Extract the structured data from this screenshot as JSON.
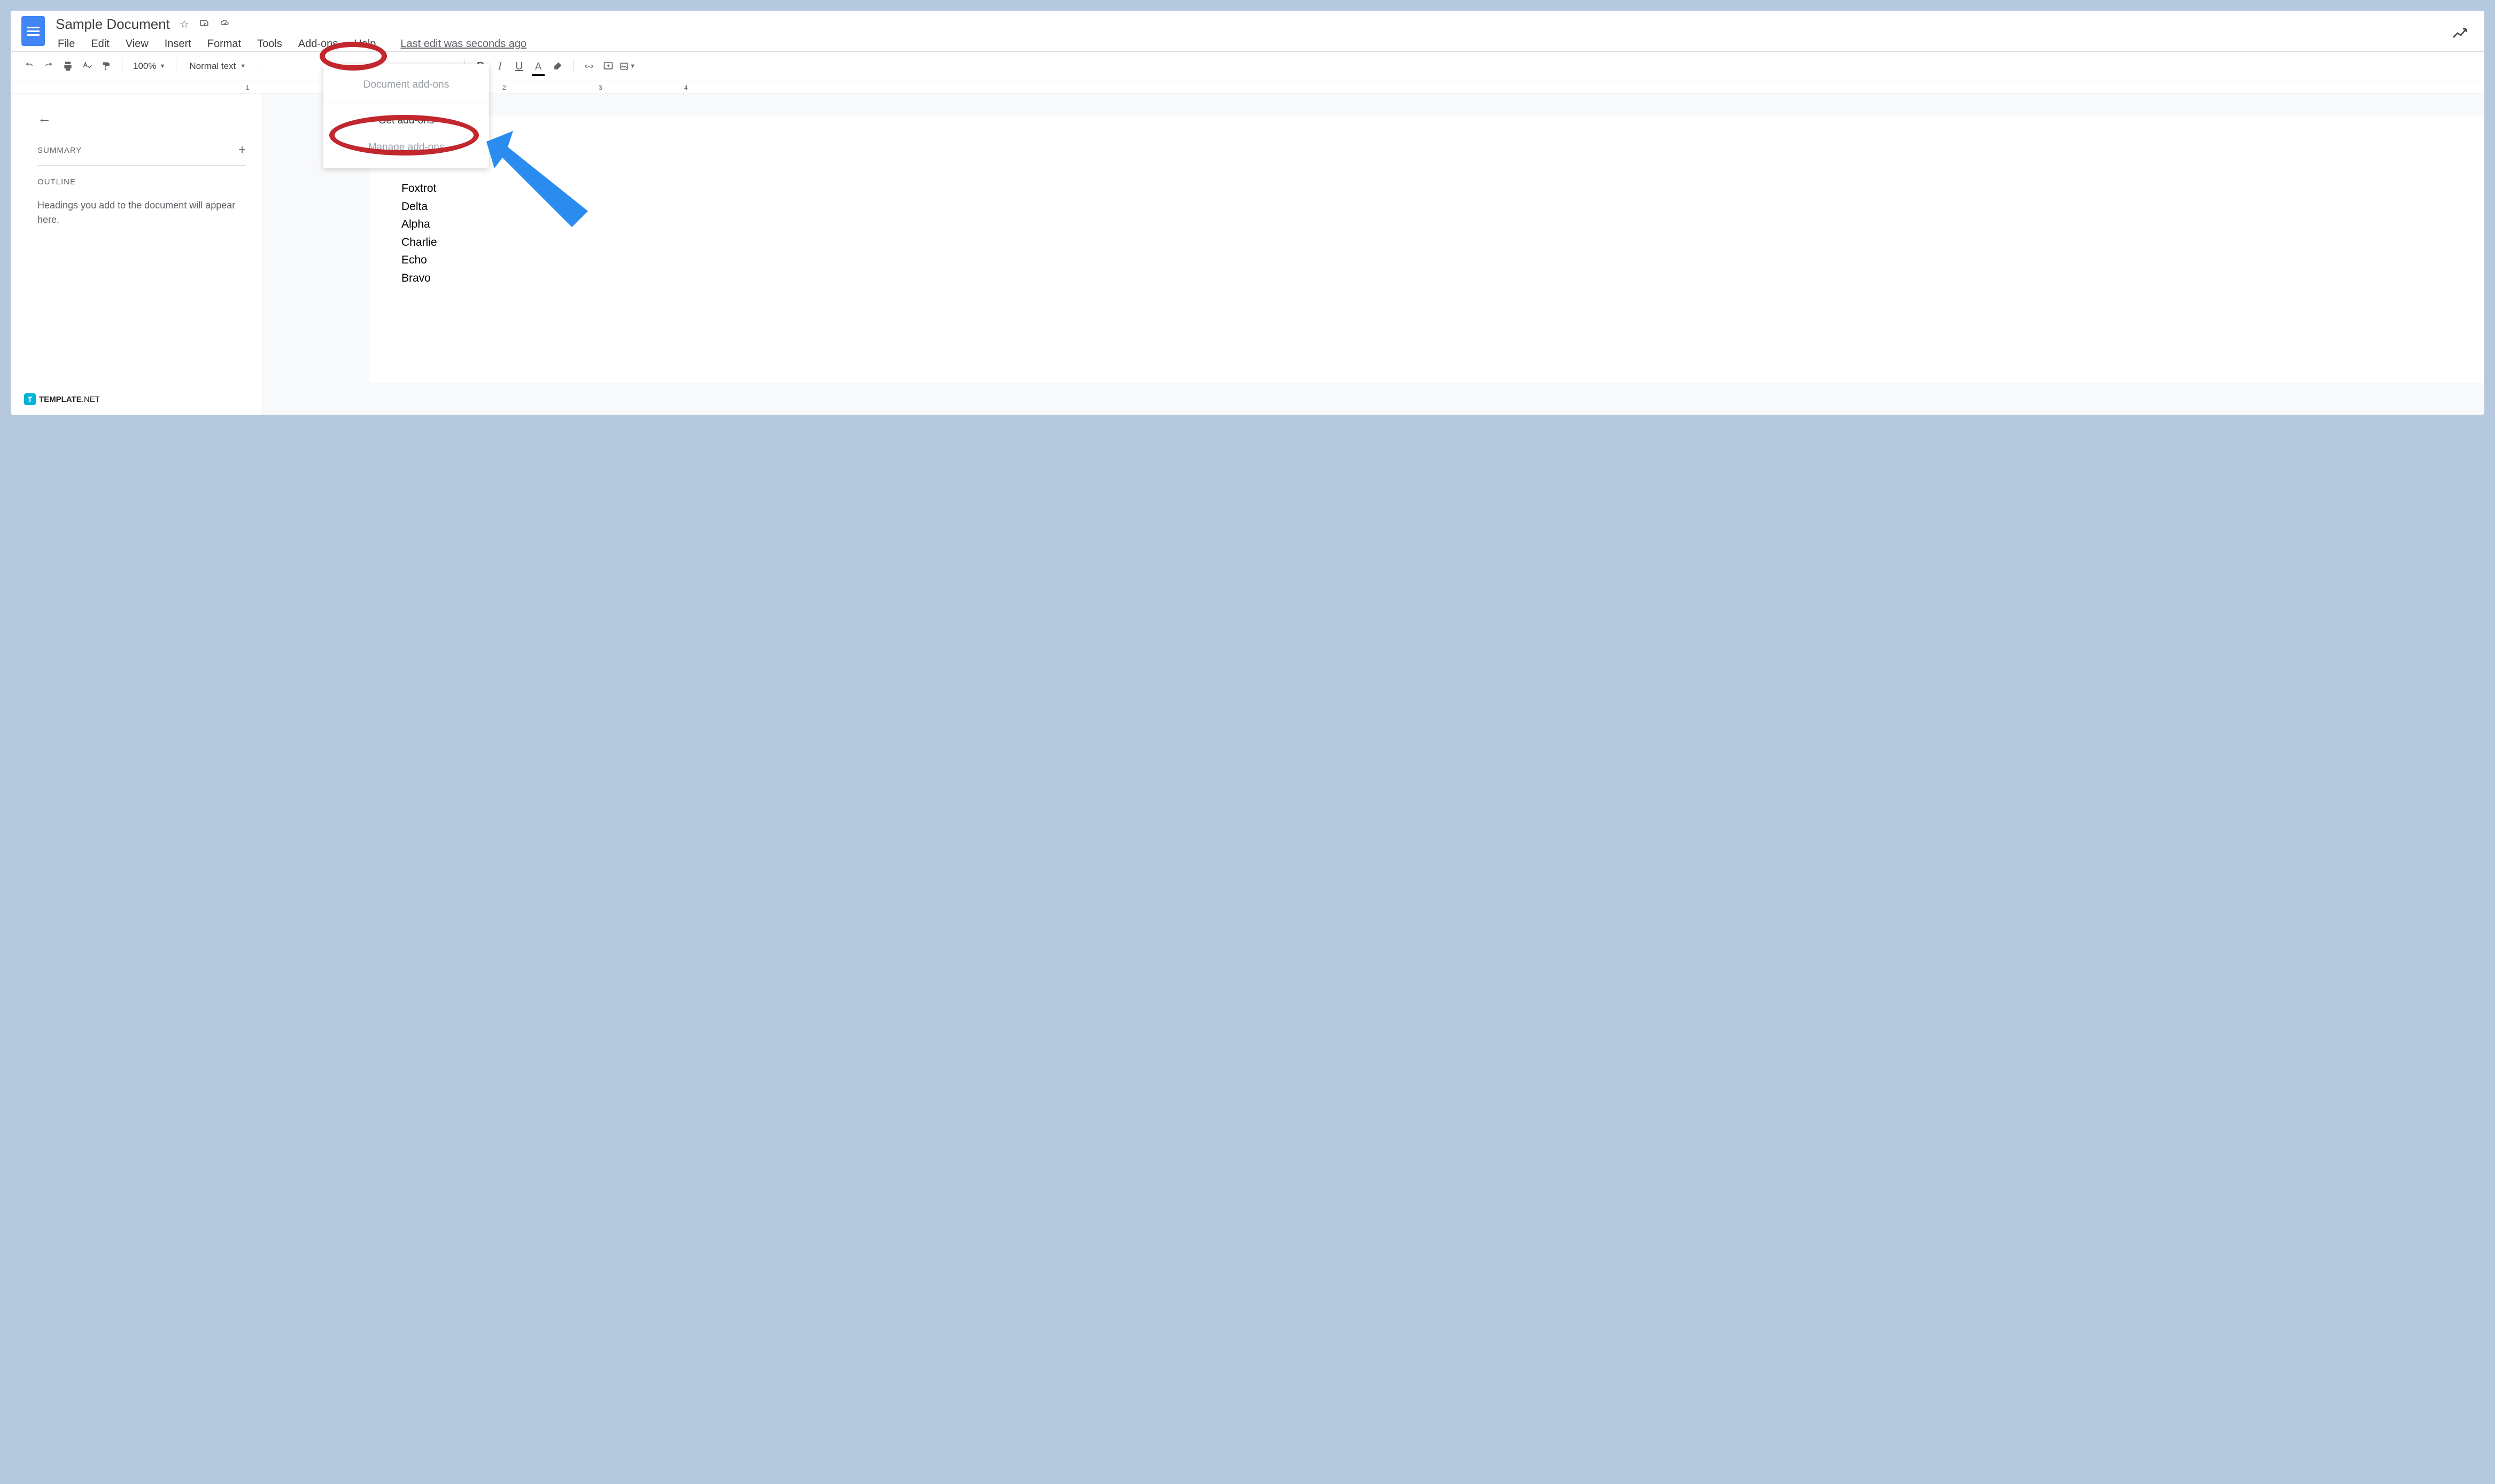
{
  "header": {
    "doc_title": "Sample Document",
    "menu": {
      "file": "File",
      "edit": "Edit",
      "view": "View",
      "insert": "Insert",
      "format": "Format",
      "tools": "Tools",
      "addons": "Add-ons",
      "help": "Help"
    },
    "last_edit": "Last edit was seconds ago"
  },
  "toolbar": {
    "zoom": "100%",
    "style": "Normal text",
    "bold": "B",
    "italic": "I",
    "underline": "U",
    "text_color": "A",
    "font_size_plus": "+"
  },
  "ruler": {
    "n1": "1",
    "n2": "2",
    "n3": "3",
    "n4": "4"
  },
  "outline": {
    "summary_label": "SUMMARY",
    "outline_label": "OUTLINE",
    "hint": "Headings you add to the document will appear here."
  },
  "dropdown": {
    "doc_addons": "Document add-ons",
    "get_addons": "Get add-ons",
    "manage_addons": "Manage add-ons"
  },
  "document": {
    "lines": [
      "Foxtrot",
      "Delta",
      "Alpha",
      "Charlie",
      "Echo",
      "Bravo"
    ]
  },
  "watermark": {
    "brand": "TEMPLATE",
    "suffix": ".NET"
  }
}
